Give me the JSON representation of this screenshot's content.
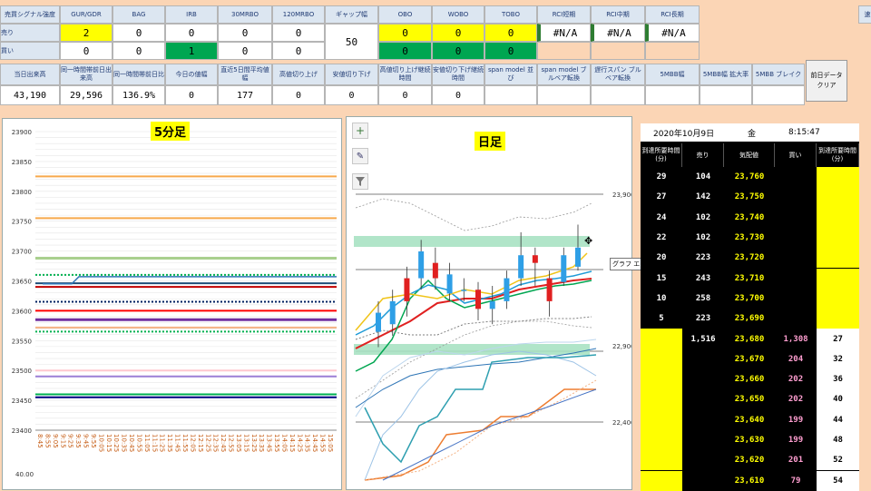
{
  "top_row1": [
    "売買シグナル強度",
    "GUR/GDR",
    "BAG",
    "IRB",
    "30MRBO",
    "120MRBO",
    "ギャップ幅",
    "OBO",
    "WOBO",
    "TOBO",
    "RCI短期",
    "RCI中期",
    "RCI長期"
  ],
  "row_sell": {
    "label": "売り",
    "values": [
      "2",
      "0",
      "0",
      "0",
      "0"
    ]
  },
  "row_buy": {
    "label": "買い",
    "values": [
      "0",
      "0",
      "1",
      "0",
      "0"
    ]
  },
  "gap_value": "50",
  "obo_row1": [
    "0",
    "0",
    "0"
  ],
  "obo_row2": [
    "0",
    "0",
    "0"
  ],
  "rci": [
    "#N/A",
    "#N/A",
    "#N/A"
  ],
  "top_row3": [
    "当日出来高",
    "同一時間帯前日出来高",
    "同一時間帯前日比",
    "今日の値幅",
    "直近5日間平均値幅",
    "高値切り上げ",
    "安値切り下げ",
    "高値切り上げ継続時間",
    "安値切り下げ継続時間",
    "span model 並び",
    "span model ブルベア転換",
    "遅行スパン ブルベア転換",
    "5MBB幅",
    "5MBB幅 拡大率",
    "5MBB ブレイク"
  ],
  "row4_values": [
    "43,190",
    "29,596",
    "136.9%",
    "0",
    "177",
    "0",
    "0",
    "0",
    "0"
  ],
  "clear_button": "前日データクリア",
  "chart5": {
    "title": "5分足",
    "bottom_label": "40.00"
  },
  "chart_daily": {
    "title": "日足",
    "tooltip": "グラフ エリア"
  },
  "orderbook": {
    "date": "2020年10月9日",
    "day": "金",
    "time": "8:15:47",
    "headers": [
      "到達所要時間(分)",
      "売り",
      "気配値",
      "買い",
      "到達所要時間(分)"
    ],
    "rows": [
      {
        "t1": "29",
        "sell": "104",
        "price": "23,760",
        "buy": "",
        "t2": ""
      },
      {
        "t1": "27",
        "sell": "142",
        "price": "23,750",
        "buy": "",
        "t2": ""
      },
      {
        "t1": "24",
        "sell": "102",
        "price": "23,740",
        "buy": "",
        "t2": ""
      },
      {
        "t1": "22",
        "sell": "102",
        "price": "23,730",
        "buy": "",
        "t2": ""
      },
      {
        "t1": "20",
        "sell": "223",
        "price": "23,720",
        "buy": "",
        "t2": ""
      },
      {
        "t1": "15",
        "sell": "243",
        "price": "23,710",
        "buy": "",
        "t2": ""
      },
      {
        "t1": "10",
        "sell": "258",
        "price": "23,700",
        "buy": "",
        "t2": ""
      },
      {
        "t1": "5",
        "sell": "223",
        "price": "23,690",
        "buy": "",
        "t2": ""
      },
      {
        "t1": "",
        "sell": "1,516",
        "price": "23,680",
        "buy": "1,308",
        "t2": "27"
      },
      {
        "t1": "",
        "sell": "",
        "price": "23,670",
        "buy": "204",
        "t2": "32"
      },
      {
        "t1": "",
        "sell": "",
        "price": "23,660",
        "buy": "202",
        "t2": "36"
      },
      {
        "t1": "",
        "sell": "",
        "price": "23,650",
        "buy": "202",
        "t2": "40"
      },
      {
        "t1": "",
        "sell": "",
        "price": "23,640",
        "buy": "199",
        "t2": "44"
      },
      {
        "t1": "",
        "sell": "",
        "price": "23,630",
        "buy": "199",
        "t2": "48"
      },
      {
        "t1": "",
        "sell": "",
        "price": "23,620",
        "buy": "201",
        "t2": "52"
      },
      {
        "t1": "",
        "sell": "",
        "price": "23,610",
        "buy": "79",
        "t2": "54"
      }
    ]
  },
  "chart_data": [
    {
      "type": "line",
      "title": "5分足",
      "ylim": [
        23400,
        23900
      ],
      "y_ticks": [
        "23900",
        "23850",
        "23800",
        "23750",
        "23700",
        "23650",
        "23600",
        "23550",
        "23500",
        "23450",
        "23400"
      ],
      "x_ticks": [
        "8:45",
        "9:05",
        "9:25",
        "9:45",
        "10:05",
        "10:25",
        "10:45",
        "11:05",
        "11:25",
        "11:45",
        "12:05",
        "12:25",
        "12:45",
        "13:05",
        "13:25",
        "13:45",
        "14:05",
        "14:25",
        "14:45",
        "15:05"
      ],
      "x_ticks_repeat": [
        "8:55",
        "9:15",
        "9:35",
        "9:55",
        "10:15",
        "10:35",
        "10:55",
        "11:15",
        "11:35",
        "11:55",
        "12:15",
        "12:35",
        "12:55",
        "13:15",
        "13:35",
        "13:55",
        "14:15",
        "14:35",
        "14:55",
        "15:15"
      ],
      "series": [
        {
          "color": "#f7a94c",
          "values": [
            23825
          ]
        },
        {
          "color": "#f7a94c",
          "values": [
            23755
          ]
        },
        {
          "color": "#a9d08e",
          "values": [
            23688
          ]
        },
        {
          "color": "#00b050",
          "values": [
            23660
          ]
        },
        {
          "color": "#1f4e79",
          "values": [
            23646
          ]
        },
        {
          "color": "#c00000",
          "values": [
            23640
          ]
        },
        {
          "color": "#002060",
          "values": [
            23615
          ]
        },
        {
          "color": "#ff0000",
          "values": [
            23600
          ]
        },
        {
          "color": "#7030a0",
          "values": [
            23585
          ]
        },
        {
          "color": "#f4b183",
          "values": [
            23572
          ]
        },
        {
          "color": "#00b050",
          "values": [
            23565
          ]
        },
        {
          "color": "#ffc7ce",
          "values": [
            23500
          ]
        },
        {
          "color": "#9b7fd6",
          "values": [
            23490
          ]
        },
        {
          "color": "#00b050",
          "values": [
            23460
          ]
        },
        {
          "color": "#000080",
          "values": [
            23455
          ]
        }
      ]
    },
    {
      "type": "candlestick",
      "title": "日足",
      "y_ticks": [
        "23,900",
        "22,900",
        "22,400"
      ],
      "candles": [
        {
          "o": 23480,
          "c": 23530,
          "h": 23560,
          "l": 23440
        },
        {
          "o": 23500,
          "c": 23560,
          "h": 23590,
          "l": 23470
        },
        {
          "o": 23620,
          "c": 23560,
          "h": 23650,
          "l": 23520
        },
        {
          "o": 23620,
          "c": 23690,
          "h": 23720,
          "l": 23590
        },
        {
          "o": 23660,
          "c": 23620,
          "h": 23700,
          "l": 23590
        },
        {
          "o": 23580,
          "c": 23630,
          "h": 23660,
          "l": 23560
        },
        {
          "o": 23590,
          "c": 23590,
          "h": 23620,
          "l": 23560
        },
        {
          "o": 23590,
          "c": 23540,
          "h": 23610,
          "l": 23510
        },
        {
          "o": 23540,
          "c": 23560,
          "h": 23600,
          "l": 23500
        },
        {
          "o": 23560,
          "c": 23620,
          "h": 23640,
          "l": 23540
        },
        {
          "o": 23620,
          "c": 23680,
          "h": 23740,
          "l": 23600
        },
        {
          "o": 23680,
          "c": 23660,
          "h": 23700,
          "l": 23600
        },
        {
          "o": 23620,
          "c": 23560,
          "h": 23640,
          "l": 23520
        },
        {
          "o": 23610,
          "c": 23680,
          "h": 23700,
          "l": 23600
        },
        {
          "o": 23650,
          "c": 23700,
          "h": 23760,
          "l": 23640
        }
      ]
    }
  ]
}
